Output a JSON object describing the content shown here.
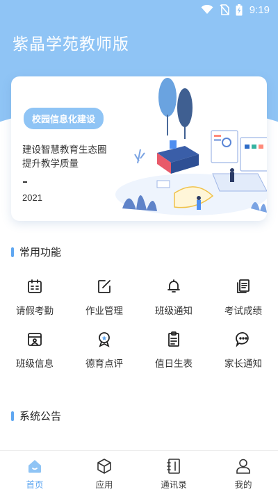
{
  "status_bar": {
    "time": "9:19"
  },
  "app": {
    "title": "紫晶学苑教师版"
  },
  "banner": {
    "tag": "校园信息化建设",
    "line1": "建设智慧教育生态圈",
    "line2": "提升教学质量",
    "dash": "-",
    "year": "2021"
  },
  "sections": {
    "common": "常用功能",
    "notice": "系统公告"
  },
  "functions": [
    {
      "label": "请假考勤",
      "icon": "calendar-icon"
    },
    {
      "label": "作业管理",
      "icon": "edit-note-icon"
    },
    {
      "label": "班级通知",
      "icon": "bell-icon"
    },
    {
      "label": "考试成绩",
      "icon": "documents-icon"
    },
    {
      "label": "班级信息",
      "icon": "class-info-icon"
    },
    {
      "label": "德育点评",
      "icon": "medal-icon"
    },
    {
      "label": "值日生表",
      "icon": "clipboard-icon"
    },
    {
      "label": "家长通知",
      "icon": "chat-bubble-icon"
    }
  ],
  "tabs": [
    {
      "label": "首页",
      "icon": "home-icon",
      "active": true
    },
    {
      "label": "应用",
      "icon": "cube-icon",
      "active": false
    },
    {
      "label": "通讯录",
      "icon": "contacts-book-icon",
      "active": false
    },
    {
      "label": "我的",
      "icon": "user-icon",
      "active": false
    }
  ],
  "colors": {
    "accent": "#5fa7f1",
    "header": "#8fc4f5",
    "icon": "#222222"
  }
}
